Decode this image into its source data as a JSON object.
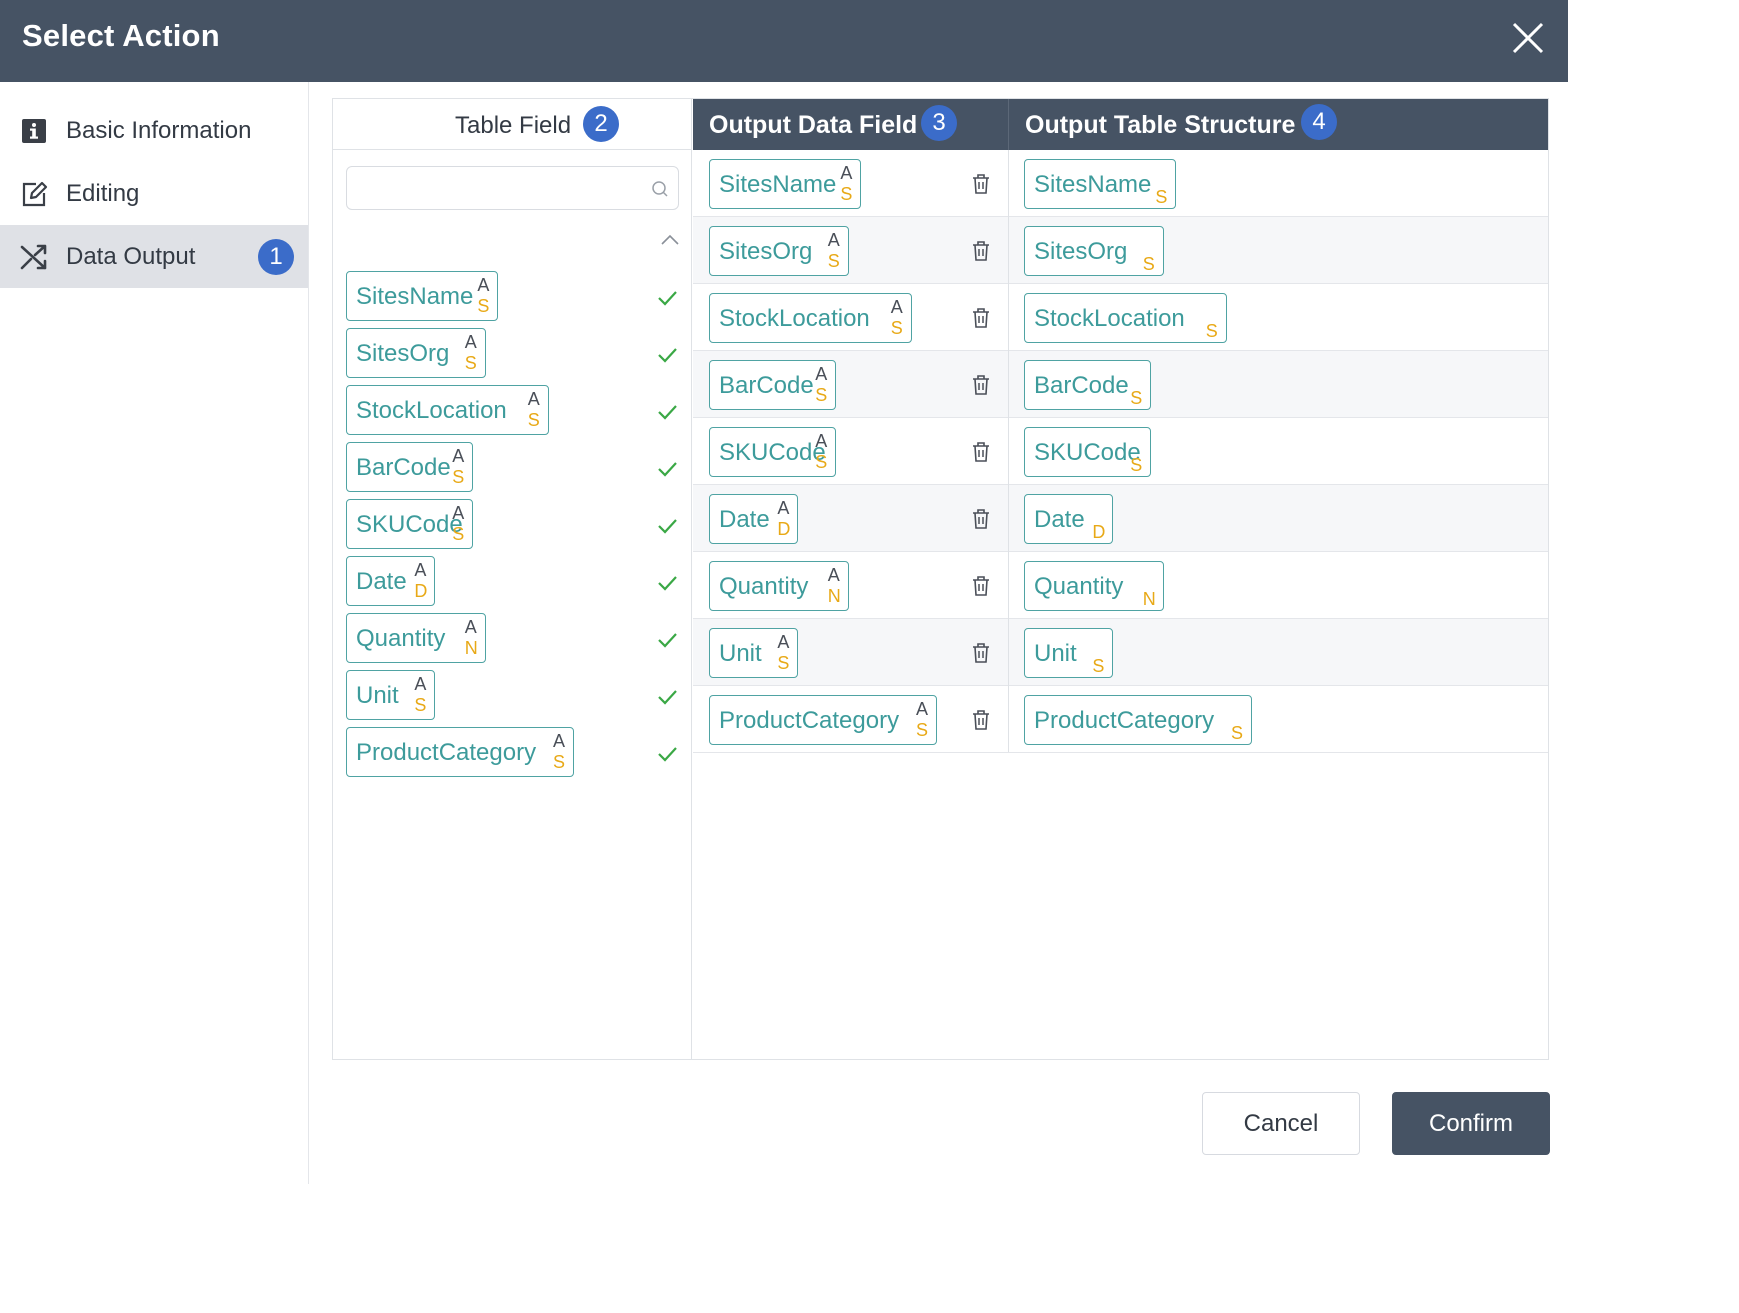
{
  "dialog": {
    "title": "Select Action",
    "close_icon": "close-icon"
  },
  "sidebar": {
    "items": [
      {
        "label": "Basic Information",
        "icon": "info-icon"
      },
      {
        "label": "Editing",
        "icon": "edit-icon"
      },
      {
        "label": "Data Output",
        "icon": "shuffle-icon",
        "badge": "1",
        "active": true
      }
    ]
  },
  "table_field": {
    "header": "Table Field",
    "badge": "2",
    "search_placeholder": "",
    "fields": [
      {
        "name": "SitesName",
        "a": "A",
        "type": "S"
      },
      {
        "name": "SitesOrg",
        "a": "A",
        "type": "S"
      },
      {
        "name": "StockLocation",
        "a": "A",
        "type": "S"
      },
      {
        "name": "BarCode",
        "a": "A",
        "type": "S"
      },
      {
        "name": "SKUCode",
        "a": "A",
        "type": "S"
      },
      {
        "name": "Date",
        "a": "A",
        "type": "D"
      },
      {
        "name": "Quantity",
        "a": "A",
        "type": "N"
      },
      {
        "name": "Unit",
        "a": "A",
        "type": "S"
      },
      {
        "name": "ProductCategory",
        "a": "A",
        "type": "S"
      }
    ]
  },
  "output_data_field": {
    "header": "Output Data Field",
    "badge": "3",
    "fields": [
      {
        "name": "SitesName",
        "a": "A",
        "type": "S"
      },
      {
        "name": "SitesOrg",
        "a": "A",
        "type": "S"
      },
      {
        "name": "StockLocation",
        "a": "A",
        "type": "S"
      },
      {
        "name": "BarCode",
        "a": "A",
        "type": "S"
      },
      {
        "name": "SKUCode",
        "a": "A",
        "type": "S"
      },
      {
        "name": "Date",
        "a": "A",
        "type": "D"
      },
      {
        "name": "Quantity",
        "a": "A",
        "type": "N"
      },
      {
        "name": "Unit",
        "a": "A",
        "type": "S"
      },
      {
        "name": "ProductCategory",
        "a": "A",
        "type": "S"
      }
    ]
  },
  "output_table_structure": {
    "header": "Output Table Structure",
    "badge": "4",
    "fields": [
      {
        "name": "SitesName",
        "type": "S"
      },
      {
        "name": "SitesOrg",
        "type": "S"
      },
      {
        "name": "StockLocation",
        "type": "S"
      },
      {
        "name": "BarCode",
        "type": "S"
      },
      {
        "name": "SKUCode",
        "type": "S"
      },
      {
        "name": "Date",
        "type": "D"
      },
      {
        "name": "Quantity",
        "type": "N"
      },
      {
        "name": "Unit",
        "type": "S"
      },
      {
        "name": "ProductCategory",
        "type": "S"
      }
    ]
  },
  "footer": {
    "cancel_label": "Cancel",
    "confirm_label": "Confirm"
  },
  "colors": {
    "header_bg": "#465364",
    "tag_text": "#3d9b9b",
    "type_letter": "#e8a917",
    "check": "#3aa845",
    "badge": "#3b6cc9"
  }
}
